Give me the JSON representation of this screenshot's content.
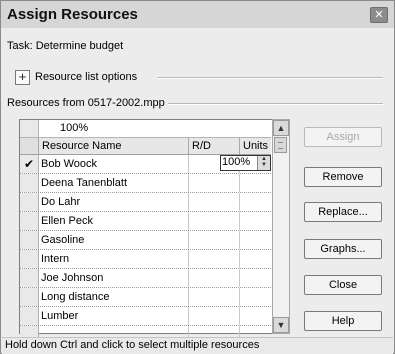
{
  "dialog": {
    "title": "Assign Resources",
    "close_icon": "close-icon"
  },
  "task_label": "Task: Determine budget",
  "resource_options": {
    "toggle": "+",
    "label": "Resource list options"
  },
  "resources_from": "Resources from 0517-2002.mpp",
  "grid": {
    "entry_value": "100%",
    "columns": [
      "Resource Name",
      "R/D",
      "Units"
    ],
    "rows": [
      {
        "check": "✔",
        "name": "Bob Woock",
        "rd": "",
        "units": "100%"
      },
      {
        "check": "",
        "name": "Deena Tanenblatt",
        "rd": "",
        "units": ""
      },
      {
        "check": "",
        "name": "Do Lahr",
        "rd": "",
        "units": ""
      },
      {
        "check": "",
        "name": "Ellen Peck",
        "rd": "",
        "units": ""
      },
      {
        "check": "",
        "name": "Gasoline",
        "rd": "",
        "units": ""
      },
      {
        "check": "",
        "name": "Intern",
        "rd": "",
        "units": ""
      },
      {
        "check": "",
        "name": "Joe Johnson",
        "rd": "",
        "units": ""
      },
      {
        "check": "",
        "name": "Long distance",
        "rd": "",
        "units": ""
      },
      {
        "check": "",
        "name": "Lumber",
        "rd": "",
        "units": ""
      },
      {
        "check": "",
        "name": "",
        "rd": "",
        "units": ""
      }
    ]
  },
  "buttons": {
    "assign": "Assign",
    "remove": "Remove",
    "replace": "Replace...",
    "graphs": "Graphs...",
    "close": "Close",
    "help": "Help"
  },
  "status_text": "Hold down Ctrl and click to select multiple resources"
}
